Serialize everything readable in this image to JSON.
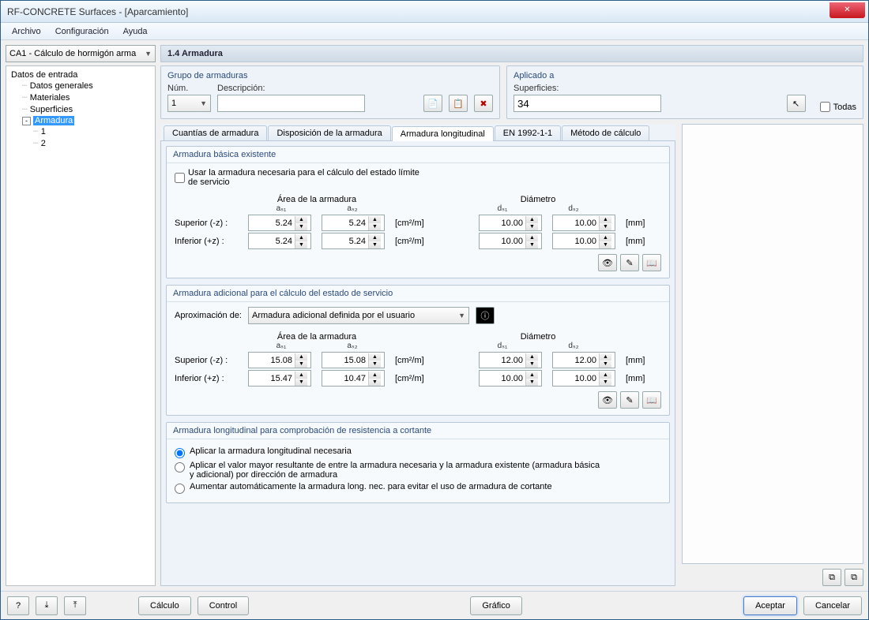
{
  "window": {
    "title": "RF-CONCRETE Surfaces - [Aparcamiento]"
  },
  "menubar": {
    "archivo": "Archivo",
    "config": "Configuración",
    "ayuda": "Ayuda"
  },
  "case_combo": "CA1 - Cálculo de hormigón arma",
  "tree": {
    "root": "Datos de entrada",
    "generales": "Datos generales",
    "materiales": "Materiales",
    "superficies": "Superficies",
    "armadura": "Armadura",
    "a1": "1",
    "a2": "2"
  },
  "section_title": "1.4 Armadura",
  "group_armaduras": {
    "title": "Grupo de armaduras",
    "num_label": "Núm.",
    "num_value": "1",
    "desc_label": "Descripción:",
    "desc_value": ""
  },
  "group_aplicado": {
    "title": "Aplicado a",
    "surf_label": "Superficies:",
    "surf_value": "34",
    "todas": "Todas"
  },
  "tabs": {
    "t1": "Cuantías de armadura",
    "t2": "Disposición de la armadura",
    "t3": "Armadura longitudinal",
    "t4": "EN 1992-1-1",
    "t5": "Método de cálculo"
  },
  "sg1": {
    "title": "Armadura básica existente",
    "chk": "Usar la armadura necesaria para el cálculo del estado límite de servicio",
    "area_hdr": "Área de la armadura",
    "diam_hdr": "Diámetro",
    "as1": "aₛ₁",
    "as2": "aₛ₂",
    "ds1": "dₛ₁",
    "ds2": "dₛ₂",
    "sup_label": "Superior (-z) :",
    "inf_label": "Inferior (+z) :",
    "unit_area": "[cm²/m]",
    "unit_diam": "[mm]",
    "sup_a1": "5.24",
    "sup_a2": "5.24",
    "sup_d1": "10.00",
    "sup_d2": "10.00",
    "inf_a1": "5.24",
    "inf_a2": "5.24",
    "inf_d1": "10.00",
    "inf_d2": "10.00"
  },
  "sg2": {
    "title": "Armadura adicional para el cálculo del estado de servicio",
    "aprox_label": "Aproximación de:",
    "aprox_value": "Armadura adicional definida por el usuario",
    "sup_a1": "15.08",
    "sup_a2": "15.08",
    "sup_d1": "12.00",
    "sup_d2": "12.00",
    "inf_a1": "15.47",
    "inf_a2": "10.47",
    "inf_d1": "10.00",
    "inf_d2": "10.00"
  },
  "sg3": {
    "title": "Armadura longitudinal para comprobación de resistencia a cortante",
    "r1": "Aplicar la armadura longitudinal necesaria",
    "r2": "Aplicar el valor mayor resultante de entre la armadura necesaria y la armadura existente (armadura básica y adicional) por dirección de armadura",
    "r3": "Aumentar automáticamente la armadura long. nec. para evitar el uso de armadura de cortante"
  },
  "footer": {
    "calculo": "Cálculo",
    "control": "Control",
    "grafico": "Gráfico",
    "aceptar": "Aceptar",
    "cancelar": "Cancelar"
  },
  "icons": {
    "new": "📄",
    "copy": "📋",
    "delete": "✖",
    "pick": "↖",
    "info": "ℹ",
    "eye": "👁",
    "edit": "✎",
    "book": "📖",
    "help": "?",
    "down1": "⤓",
    "down2": "⤒",
    "panel1": "⧉",
    "panel2": "⧉"
  }
}
